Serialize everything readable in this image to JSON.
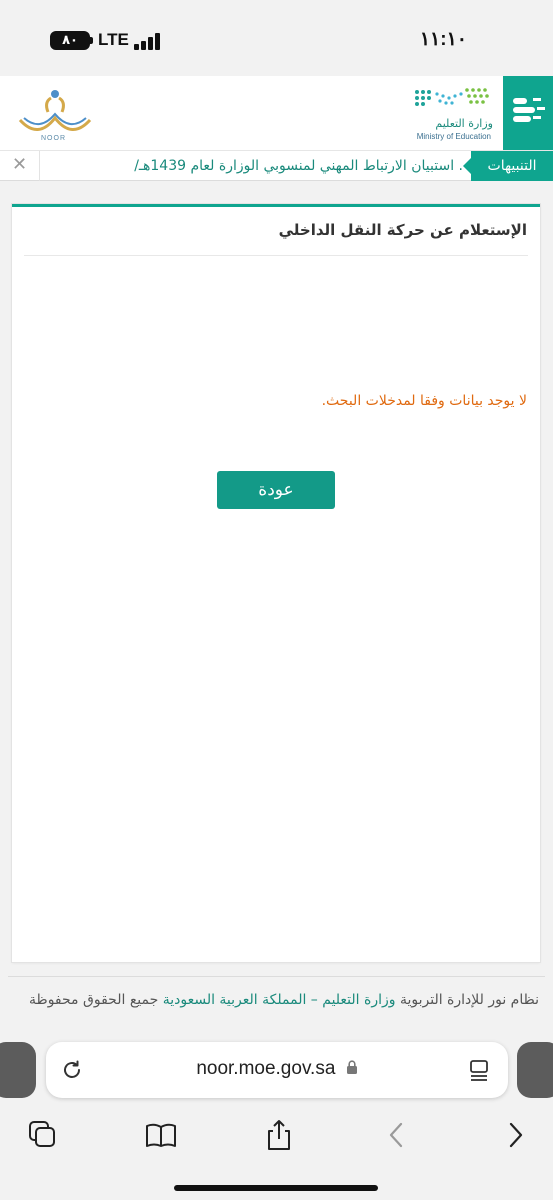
{
  "status_bar": {
    "battery": "٨٠",
    "network": "LTE",
    "time": "١١:١٠"
  },
  "header": {
    "moe_name_ar": "وزارة التعليم",
    "moe_name_en": "Ministry of Education",
    "noor_label": "NOOR",
    "brand_color": "#0fa58f"
  },
  "alerts": {
    "label": "التنبيهات",
    "ticker": ". استبيان الارتباط المهني لمنسوبي الوزارة لعام 1439هـ/"
  },
  "card": {
    "title": "الإستعلام عن حركة النقل الداخلي",
    "message": "لا يوجد بيانات وفقا لمدخلات البحث.",
    "back_button": "عودة"
  },
  "footer": {
    "part1": "نظام نور للإدارة التربوية ",
    "link1": "وزارة التعليم – المملكة العربية السعودية",
    "part2": " جميع الحقوق محفوظة"
  },
  "browser": {
    "url": "noor.moe.gov.sa"
  }
}
